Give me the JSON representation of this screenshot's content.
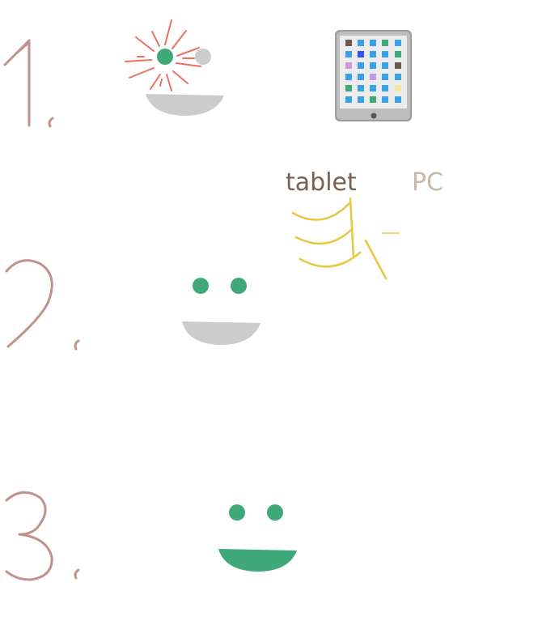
{
  "steps": [
    {
      "number": "1",
      "state": "dizzy"
    },
    {
      "number": "2",
      "state": "neutral"
    },
    {
      "number": "3",
      "state": "happy"
    }
  ],
  "choices": {
    "tablet_label": "tablet",
    "pc_label": "PC",
    "selected": "tablet"
  },
  "colors": {
    "number": "#c0928f",
    "eye": "#3fa97a",
    "mouth_gray": "#cccccc",
    "mouth_green": "#3fa97a",
    "burst": "#f07060",
    "tablet_label": "#7a6050",
    "pc_label": "#c7b8ae",
    "tap_marks": "#e8c840"
  },
  "icons": {
    "tablet": "tablet-icon",
    "tap": "tap-marks-icon"
  }
}
